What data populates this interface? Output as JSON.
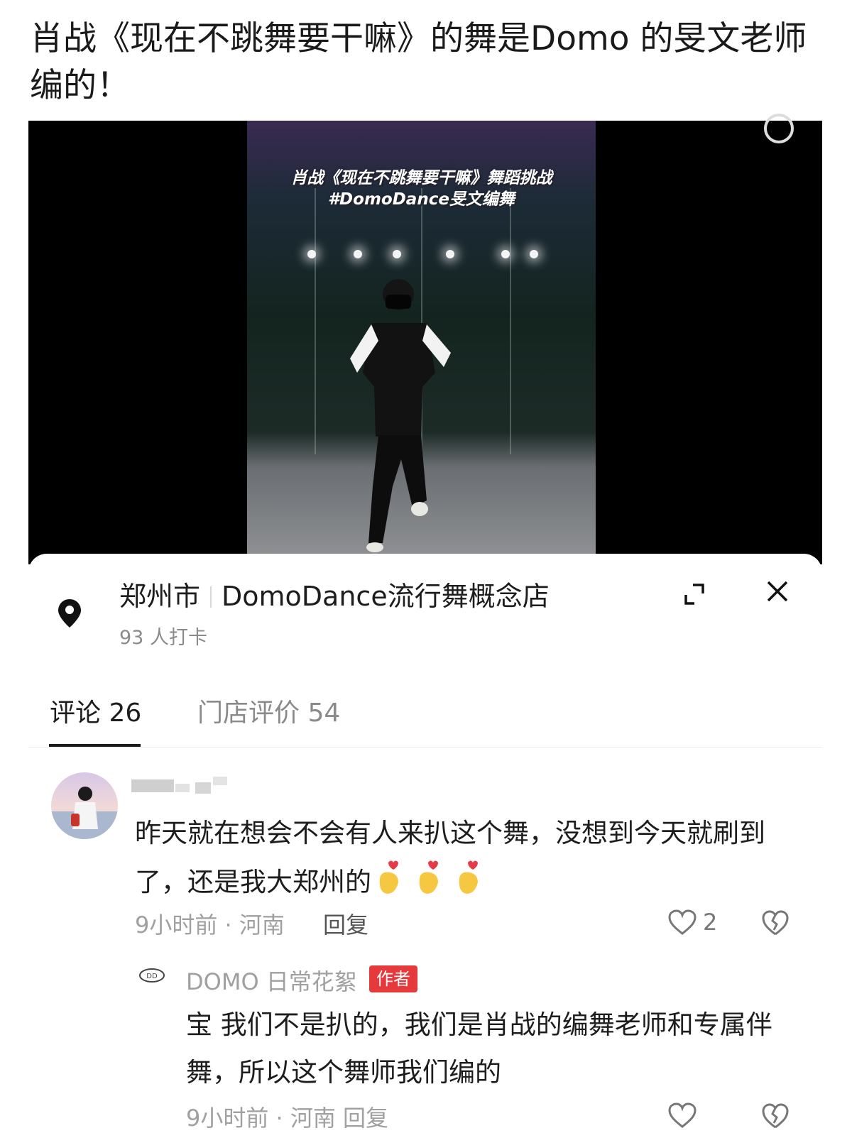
{
  "headline": "肖战《现在不跳舞要干嘛》的舞是Domo 的旻文老师编的！",
  "video": {
    "caption_line1": "肖战《现在不跳舞要干嘛》舞蹈挑战",
    "caption_line2": "#DomoDance旻文编舞"
  },
  "location": {
    "city": "郑州市",
    "store": "DomoDance流行舞概念店",
    "checkins": "93 人打卡"
  },
  "tabs": [
    {
      "label": "评论 26"
    },
    {
      "label": "门店评价 54"
    }
  ],
  "comment": {
    "text": "昨天就在想会不会有人来扒这个舞，没想到今天就刷到了，还是我大郑州的",
    "meta": "9小时前 · 河南",
    "reply_label": "回复",
    "likes": "2"
  },
  "reply": {
    "user": "DOMO 日常花絮",
    "badge": "作者",
    "text": "宝 我们不是扒的，我们是肖战的编舞老师和专属伴舞，所以这个舞师我们编的",
    "meta_partial": "9小时前 · 河南    回复"
  },
  "colors": {
    "badge": "#e5393b",
    "muted_text": "#a0a0a0",
    "heart_emoji": "#f6c842"
  }
}
